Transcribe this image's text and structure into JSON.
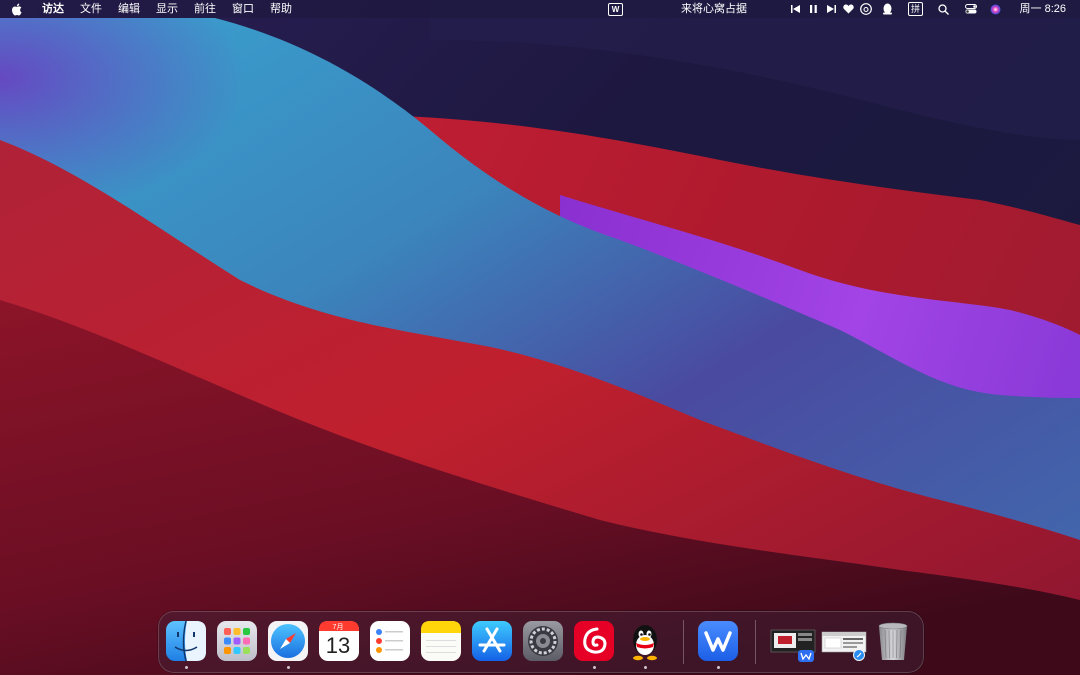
{
  "menubar": {
    "apple_icon": "apple-logo-icon",
    "menus": [
      "访达",
      "文件",
      "编辑",
      "显示",
      "前往",
      "窗口",
      "帮助"
    ],
    "center_app_icon": "W",
    "now_playing": "来将心窝占据",
    "right_icons": [
      "previous-track-icon",
      "pause-icon",
      "next-track-icon",
      "heart-icon",
      "netease-music-icon",
      "qq-penguin-icon",
      "input-method-icon",
      "spotlight-icon",
      "control-center-icon",
      "siri-icon"
    ],
    "input_method_label": "拼",
    "clock": "周一 8:26"
  },
  "dock": {
    "calendar": {
      "month": "7月",
      "day": "13"
    },
    "apps": [
      {
        "name": "finder",
        "running": true
      },
      {
        "name": "launchpad",
        "running": false
      },
      {
        "name": "safari",
        "running": true
      },
      {
        "name": "calendar",
        "running": false
      },
      {
        "name": "reminders",
        "running": false
      },
      {
        "name": "notes",
        "running": false
      },
      {
        "name": "app-store",
        "running": false
      },
      {
        "name": "system-preferences",
        "running": false
      },
      {
        "name": "netease-cloud-music",
        "running": true
      },
      {
        "name": "qq",
        "running": true
      },
      {
        "name": "wps-office",
        "running": true
      },
      {
        "name": "minimized-wps-window",
        "running": false
      },
      {
        "name": "minimized-safari-window",
        "running": false
      },
      {
        "name": "trash",
        "running": false
      }
    ]
  },
  "colors": {
    "wallpaper_red": "#b3192e",
    "wallpaper_blue": "#3a8fc0",
    "wallpaper_purple": "#a23be0",
    "wallpaper_navy": "#1f1a45"
  }
}
